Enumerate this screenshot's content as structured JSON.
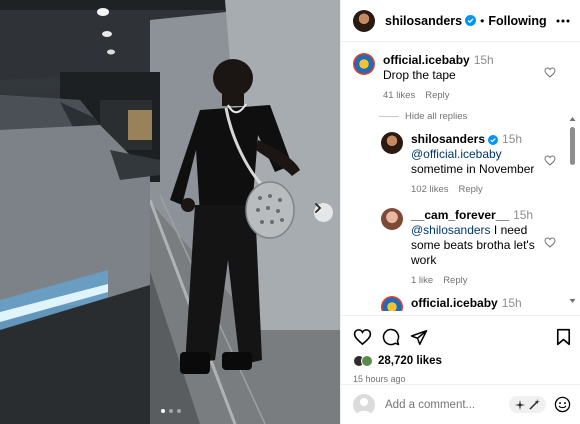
{
  "post": {
    "author": "shilosanders",
    "follow_status": "Following",
    "separator": "•",
    "likes": "28,720 likes",
    "time_ago": "15 hours ago"
  },
  "comments": [
    {
      "user": "official.icebaby",
      "time": "15h",
      "text": "Drop the tape",
      "likes": "41 likes",
      "reply_label": "Reply",
      "avatar": "icebaby-avatar"
    },
    {
      "user": "shilosanders",
      "time": "15h",
      "mention": "@official.icebaby",
      "text": "sometime in November",
      "likes": "102 likes",
      "reply_label": "Reply",
      "avatar": "shilo-avatar"
    },
    {
      "user": "__cam_forever__",
      "time": "15h",
      "mention": "@shilosanders",
      "text": "I need some beats brotha let's work",
      "likes": "1 like",
      "reply_label": "Reply",
      "avatar": "cam-avatar"
    },
    {
      "user": "official.icebaby",
      "time": "15h",
      "avatar": "icebaby-avatar"
    }
  ],
  "hide_replies_label": "Hide all replies",
  "input": {
    "placeholder": "Add a comment..."
  },
  "icons": {
    "verified": "verified-badge-icon",
    "more": "more-options-icon",
    "heart": "heart-icon",
    "comment": "comment-icon",
    "share": "share-icon",
    "save": "bookmark-icon",
    "emoji": "emoji-icon",
    "ai": "sparkle-icon",
    "next": "chevron-right-icon"
  },
  "colors": {
    "verified": "#0095f6",
    "mention": "#00376b",
    "muted": "#737373"
  },
  "carousel": {
    "count": 3,
    "active": 1
  }
}
